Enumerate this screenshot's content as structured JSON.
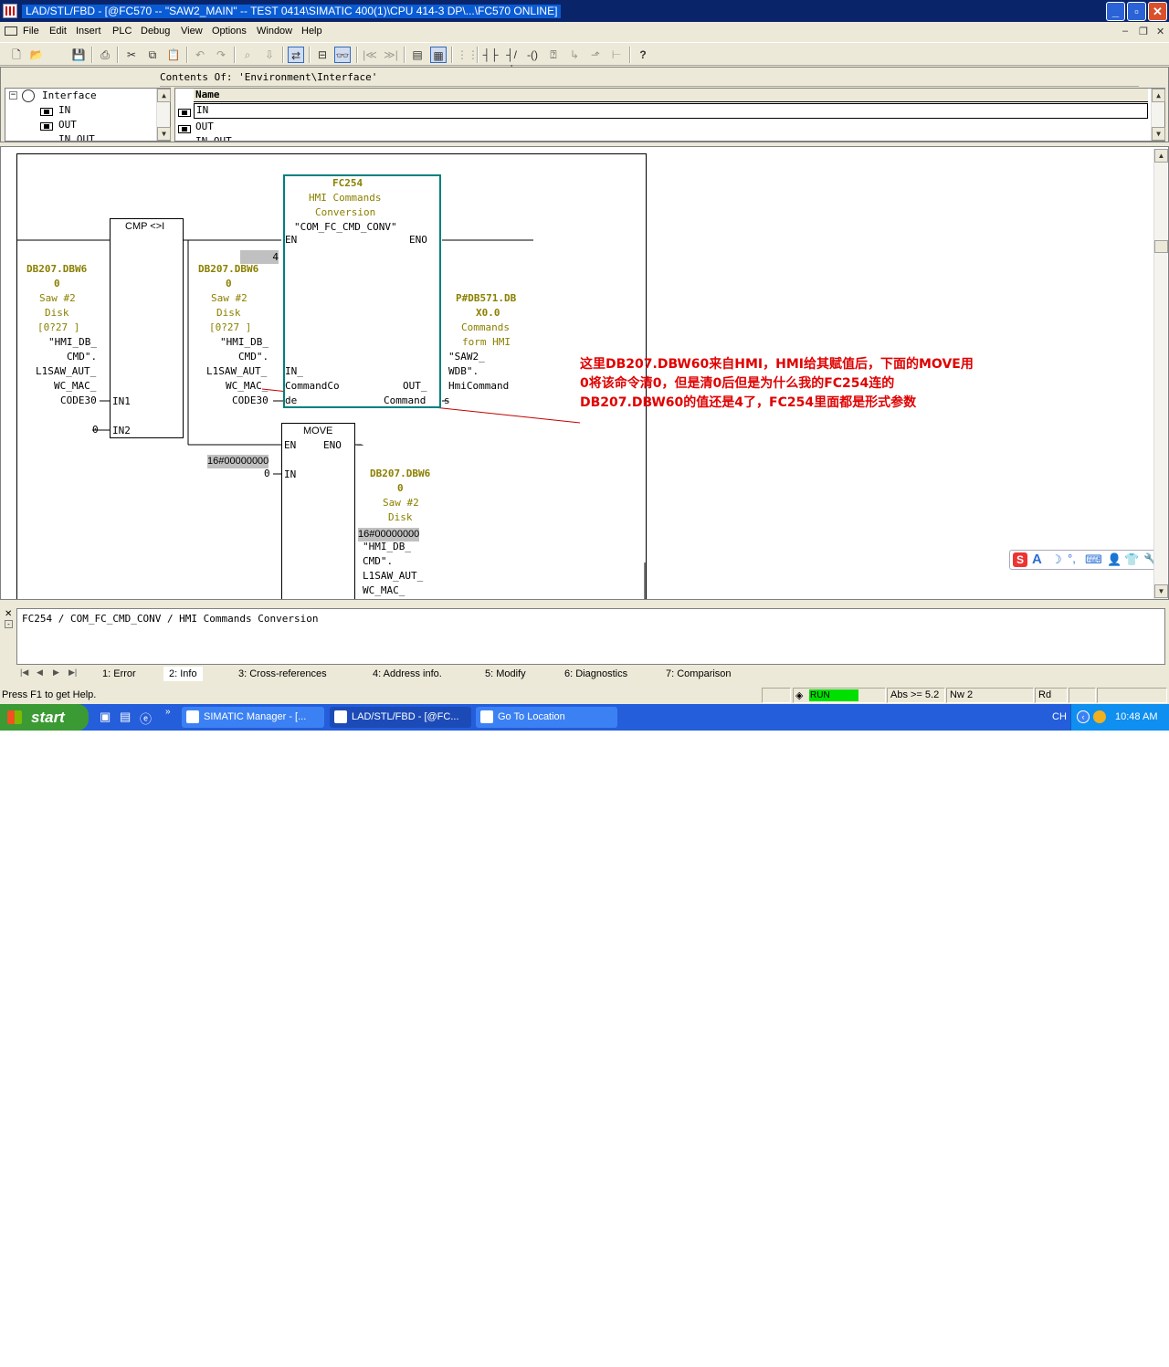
{
  "window": {
    "title": "LAD/STL/FBD  - [@FC570 -- \"SAW2_MAIN\" -- TEST 0414\\SIMATIC 400(1)\\CPU 414-3 DP\\...\\FC570  ONLINE]"
  },
  "menu": [
    "File",
    "Edit",
    "Insert",
    "PLC",
    "Debug",
    "View",
    "Options",
    "Window",
    "Help"
  ],
  "interface": {
    "contents_label": "Contents Of: 'Environment\\Interface'",
    "tree": {
      "root": "Interface",
      "items": [
        "IN",
        "OUT",
        "IN_OUT"
      ]
    },
    "table": {
      "header": "Name",
      "rows": [
        "IN",
        "OUT",
        "IN_OUT"
      ]
    }
  },
  "diagram": {
    "cmp": {
      "title": "CMP <>I",
      "in1": "IN1",
      "in2": "IN2",
      "in2_value": "0"
    },
    "left_operand": {
      "line1": "DB207.DBW6",
      "line2": "0",
      "line3": "Saw #2",
      "line4": "Disk",
      "line5": "[0?27 ]",
      "line6": "\"HMI_DB_",
      "line7": "CMD\".",
      "line8": "L1SAW_AUT_",
      "line9": "WC_MAC_",
      "line10": "CODE30"
    },
    "mid_operand": {
      "value": "4",
      "line1": "DB207.DBW6",
      "line2": "0",
      "line3": "Saw #2",
      "line4": "Disk",
      "line5": "[0?27 ]",
      "line6": "\"HMI_DB_",
      "line7": "CMD\".",
      "line8": "L1SAW_AUT_",
      "line9": "WC_MAC_",
      "line10": "CODE30"
    },
    "fc": {
      "name": "FC254",
      "desc1": "HMI Commands",
      "desc2": "Conversion",
      "symbol": "\"COM_FC_CMD_CONV\"",
      "en": "EN",
      "eno": "ENO",
      "in1": "IN_",
      "in2": "CommandCo",
      "in3": "de",
      "out1": "OUT_",
      "out2": "Command",
      "out3": "s"
    },
    "fc_output": {
      "line1": "P#DB571.DB",
      "line2": "X0.0",
      "line3": "Commands",
      "line4": "form HMI",
      "line5": "\"SAW2_",
      "line6": "WDB\".",
      "line7": "HmiCommand"
    },
    "move": {
      "title": "MOVE",
      "en": "EN",
      "eno": "ENO",
      "in": "IN",
      "in_status": "16#00000000",
      "in_value": "0"
    },
    "move_output": {
      "line1": "DB207.DBW6",
      "line2": "0",
      "line3": "Saw #2",
      "line4": "Disk",
      "status": "16#00000000",
      "line6": "\"HMI_DB_",
      "line7": "CMD\".",
      "line8": "L1SAW_AUT_",
      "line9": "WC_MAC_"
    },
    "annotation": "这里DB207.DBW60来自HMI，HMI给其赋值后，下面的MOVE用0将该命令清0，但是清0后但是为什么我的FC254连的DB207.DBW60的值还是4了，FC254里面都是形式参数"
  },
  "output_window": {
    "text": "FC254 / COM_FC_CMD_CONV / HMI Commands Conversion",
    "tabs": [
      "1: Error",
      "2: Info",
      "3: Cross-references",
      "4: Address info.",
      "5: Modify",
      "6: Diagnostics",
      "7: Comparison"
    ],
    "active_tab": "2: Info"
  },
  "statusbar": {
    "help": "Press F1 to get Help.",
    "run": "RUN",
    "abs": "Abs >= 5.2",
    "nw": "Nw 2",
    "mode": "Rd"
  },
  "taskbar": {
    "start": "start",
    "tasks": [
      "SIMATIC Manager - [...",
      "LAD/STL/FBD  - [@FC...",
      "Go To Location"
    ],
    "lang": "CH",
    "clock": "10:48 AM"
  },
  "colors": {
    "title_bar": "#0a246a",
    "operand_text": "#8b8000",
    "fc_box_border": "#008080",
    "annotation": "#e00000",
    "run_indicator": "#00e000",
    "taskbar": "#245edb"
  }
}
